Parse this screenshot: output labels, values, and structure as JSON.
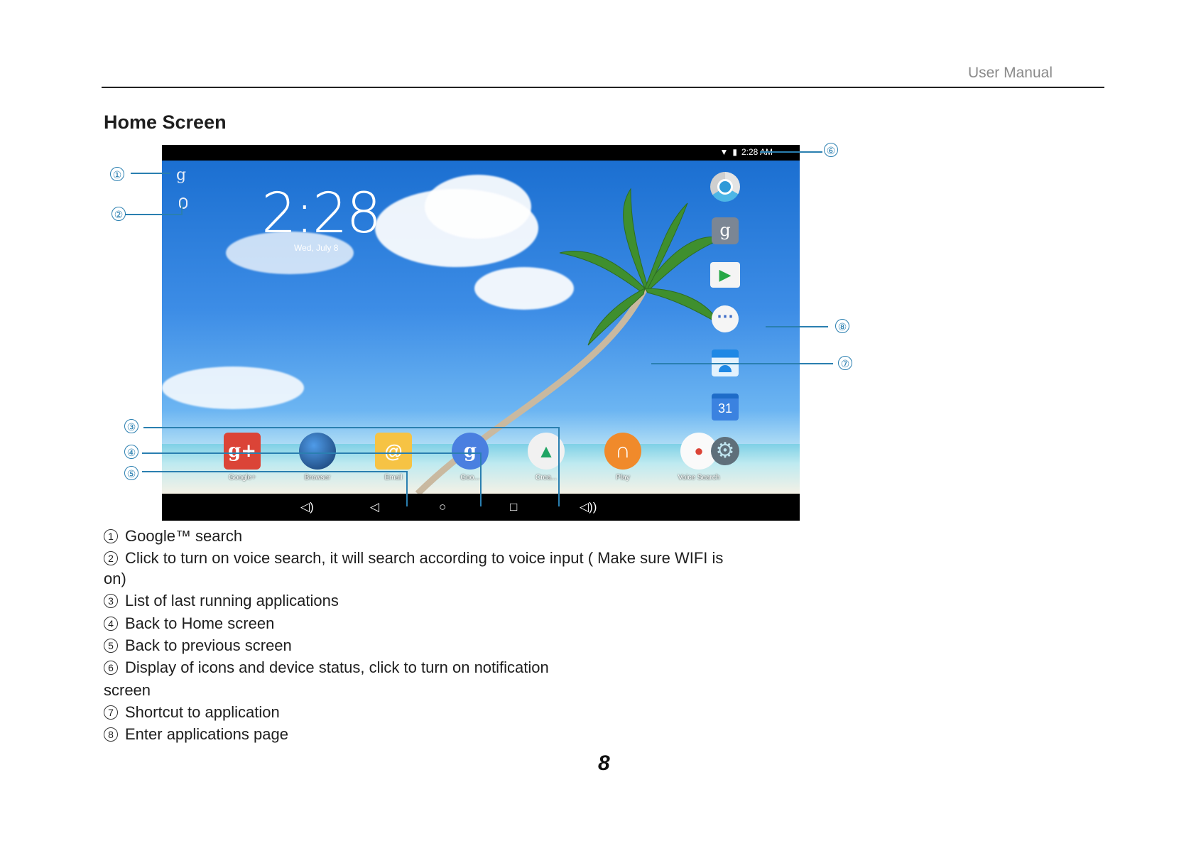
{
  "header": {
    "title": "User Manual"
  },
  "section": {
    "title": "Home Screen"
  },
  "tablet": {
    "status_time": "2:28 AM",
    "clock": "2:28",
    "date": "Wed, July 8",
    "google_logo": "g",
    "dock": [
      {
        "label": "Google+",
        "icon": "google-plus-icon",
        "color": "#db4437",
        "glyph": "g+"
      },
      {
        "label": "Browser",
        "icon": "globe-icon",
        "color": "#1d4f8c",
        "glyph": ""
      },
      {
        "label": "Email",
        "icon": "email-icon",
        "color": "#f6c344",
        "glyph": "@"
      },
      {
        "label": "Google",
        "icon": "google-icon",
        "color": "#4a7fe0",
        "glyph": "g"
      },
      {
        "label": "Create",
        "icon": "drive-icon",
        "color": "#ffffff",
        "glyph": "▲"
      },
      {
        "label": "Play",
        "icon": "headphones-icon",
        "color": "#f08a2b",
        "glyph": "∩"
      },
      {
        "label": "Voice Search",
        "icon": "microphone-icon",
        "color": "#ffffff",
        "glyph": "●"
      }
    ],
    "side": [
      {
        "icon": "chrome-icon",
        "glyph": ""
      },
      {
        "icon": "google-icon",
        "glyph": "g"
      },
      {
        "icon": "play-store-icon",
        "glyph": "▶"
      },
      {
        "icon": "app-drawer-icon",
        "glyph": "⋯"
      },
      {
        "icon": "contacts-icon",
        "glyph": ""
      },
      {
        "icon": "calendar-icon",
        "glyph": "31"
      },
      {
        "icon": "settings-icon",
        "glyph": "⚙"
      }
    ],
    "dock_labels_shown": [
      "Google+",
      "Browser",
      "Email",
      "Goo...",
      "Crea...",
      "Play",
      "Voice Search"
    ]
  },
  "callouts": [
    "①",
    "②",
    "③",
    "④",
    "⑤",
    "⑥",
    "⑦",
    "⑧"
  ],
  "descriptions": [
    {
      "num": "1",
      "text": "Google™ search"
    },
    {
      "num": "2",
      "text": "Click to turn on voice search, it will search according to voice input ( Make sure WIFI is"
    },
    {
      "num": "",
      "text": "on)"
    },
    {
      "num": "3",
      "text": "List of last running applications"
    },
    {
      "num": "4",
      "text": "Back to Home screen"
    },
    {
      "num": "5",
      "text": "Back to previous screen"
    },
    {
      "num": "6",
      "text": "Display of icons and device status, click to turn on notification"
    },
    {
      "num": "",
      "text": "screen"
    },
    {
      "num": "7",
      "text": "Shortcut to application"
    },
    {
      "num": "8",
      "text": "Enter applications page"
    }
  ],
  "page_number": "8"
}
